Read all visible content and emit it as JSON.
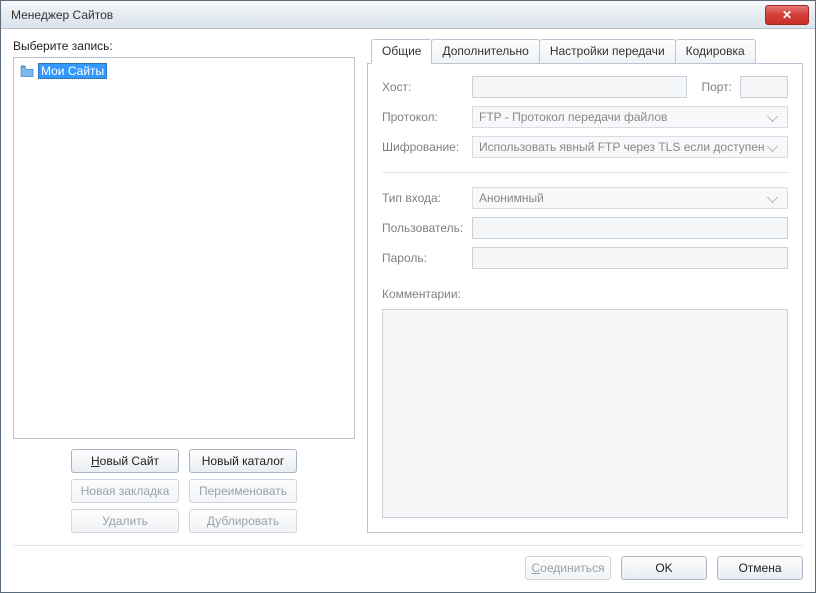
{
  "window": {
    "title": "Менеджер Сайтов"
  },
  "left": {
    "prompt": "Выберите запись:",
    "root_item": "Мои Сайты",
    "buttons": {
      "new_site": "Новый Сайт",
      "new_folder": "Новый каталог",
      "new_bookmark": "Новая закладка",
      "rename": "Переименовать",
      "delete": "Удалить",
      "duplicate": "Дублировать"
    }
  },
  "tabs": {
    "general": "Общие",
    "advanced": "Дополнительно",
    "transfer": "Настройки передачи",
    "charset": "Кодировка"
  },
  "form": {
    "host_label": "Хост:",
    "host_value": "",
    "port_label": "Порт:",
    "port_value": "",
    "protocol_label": "Протокол:",
    "protocol_value": "FTP - Протокол передачи файлов",
    "encryption_label": "Шифрование:",
    "encryption_value": "Использовать явный FTP через TLS если доступен",
    "logon_label": "Тип входа:",
    "logon_value": "Анонимный",
    "user_label": "Пользователь:",
    "user_value": "",
    "pass_label": "Пароль:",
    "pass_value": "",
    "comments_label": "Комментарии:",
    "comments_value": ""
  },
  "footer": {
    "connect": "Соединиться",
    "ok": "OK",
    "cancel": "Отмена"
  }
}
